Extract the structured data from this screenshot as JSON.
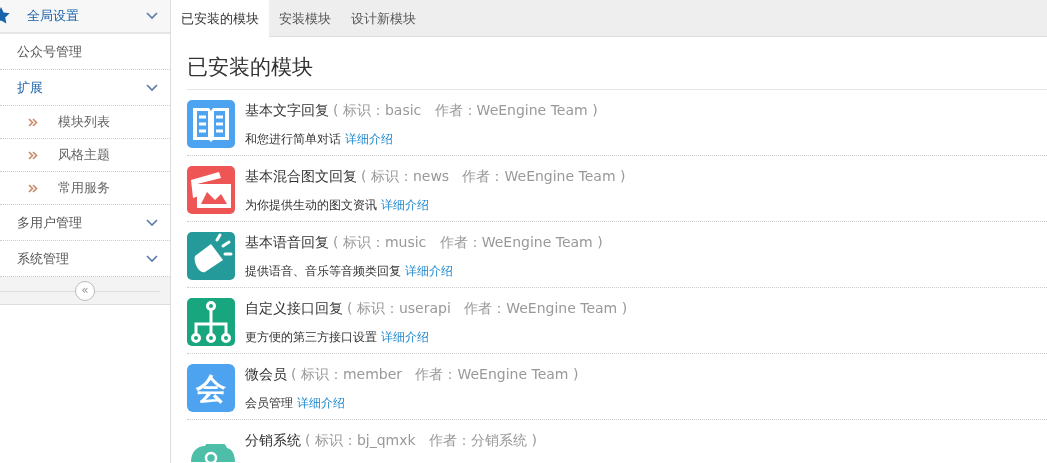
{
  "sidebar": {
    "items": [
      {
        "label": "全局设置",
        "kind": "header",
        "active": true,
        "expandable": true
      },
      {
        "label": "公众号管理",
        "kind": "item",
        "active": false,
        "expandable": false
      },
      {
        "label": "扩展",
        "kind": "item",
        "active": true,
        "expandable": true,
        "children": [
          {
            "label": "模块列表"
          },
          {
            "label": "风格主题"
          },
          {
            "label": "常用服务"
          }
        ]
      },
      {
        "label": "多用户管理",
        "kind": "item",
        "active": false,
        "expandable": true
      },
      {
        "label": "系统管理",
        "kind": "item",
        "active": false,
        "expandable": true
      }
    ],
    "collapse_label": "«"
  },
  "tabs": [
    {
      "label": "已安装的模块",
      "selected": true
    },
    {
      "label": "安装模块",
      "selected": false
    },
    {
      "label": "设计新模块",
      "selected": false
    }
  ],
  "heading": "已安装的模块",
  "modules": [
    {
      "kind": "book",
      "title": "基本文字回复",
      "meta": "( 标识：basic   作者：WeEngine Team )",
      "description": "和您进行简单对话",
      "link": "详细介绍"
    },
    {
      "kind": "photo",
      "title": "基本混合图文回复",
      "meta": "( 标识：news   作者：WeEngine Team )",
      "description": "为你提供生动的图文资讯",
      "link": "详细介绍"
    },
    {
      "kind": "speaker",
      "title": "基本语音回复",
      "meta": "( 标识：music   作者：WeEngine Team )",
      "description": "提供语音、音乐等音频类回复",
      "link": "详细介绍"
    },
    {
      "kind": "tree",
      "title": "自定义接口回复",
      "meta": "( 标识：userapi   作者：WeEngine Team )",
      "description": "更方便的第三方接口设置",
      "link": "详细介绍"
    },
    {
      "kind": "glyph",
      "icon_text": "会",
      "title": "微会员",
      "meta": "( 标识：member   作者：WeEngine Team )",
      "description": "会员管理",
      "link": "详细介绍"
    },
    {
      "kind": "cloud",
      "title": "分销系统",
      "meta": "( 标识：bj_qmxk   作者：分销系统 )"
    }
  ]
}
